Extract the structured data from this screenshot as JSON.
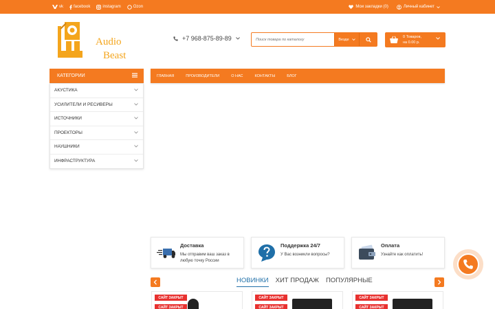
{
  "topbar": {
    "social": [
      {
        "icon": "vk-icon",
        "label": "vk"
      },
      {
        "icon": "facebook-icon",
        "label": "facebook"
      },
      {
        "icon": "instagram-icon",
        "label": "instagram"
      },
      {
        "icon": "ozon-icon",
        "label": "Ozon"
      }
    ],
    "bookmarks": "Мои закладки (0)",
    "account": "Личный кабинет"
  },
  "header": {
    "logo_line1": "Audio",
    "logo_line2": "Beast",
    "phone": "+7 968-875-89-89",
    "search_placeholder": "Поиск товара по каталогу",
    "search_scope": "Везде",
    "cart_line1": "0 Товаров,",
    "cart_line2": "на 0.00 р."
  },
  "categories": {
    "title": "КАТЕГОРИИ",
    "items": [
      "АКУСТИКА",
      "УСИЛИТЕЛИ И РЕСИВЕРЫ",
      "ИСТОЧНИКИ",
      "ПРОЕКТОРЫ",
      "НАУШНИКИ",
      "ИНФРАСТРУКТУРА"
    ]
  },
  "nav": [
    "ГЛАВНАЯ",
    "ПРОИЗВОДИТЕЛИ",
    "О НАС",
    "КОНТАКТЫ",
    "БЛОГ"
  ],
  "features": [
    {
      "title": "Доставка",
      "desc": "Мы отправим ваш заказ в любую точку России",
      "icon": "delivery-truck-icon"
    },
    {
      "title": "Поддержка 24/7",
      "desc": "У Вас возникли вопросы?",
      "icon": "question-icon"
    },
    {
      "title": "Оплата",
      "desc": "Узнайте как оплатить!",
      "icon": "payment-wallet-icon"
    }
  ],
  "tabs": [
    "НОВИНКИ",
    "ХИТ ПРОДАЖ",
    "ПОПУЛЯРНЫЕ"
  ],
  "product_badge": "САЙТ ЗАКРЫТ",
  "colors": {
    "accent": "#f47a20",
    "tab_active": "#1f6fa8",
    "badge": "#e8312f"
  }
}
